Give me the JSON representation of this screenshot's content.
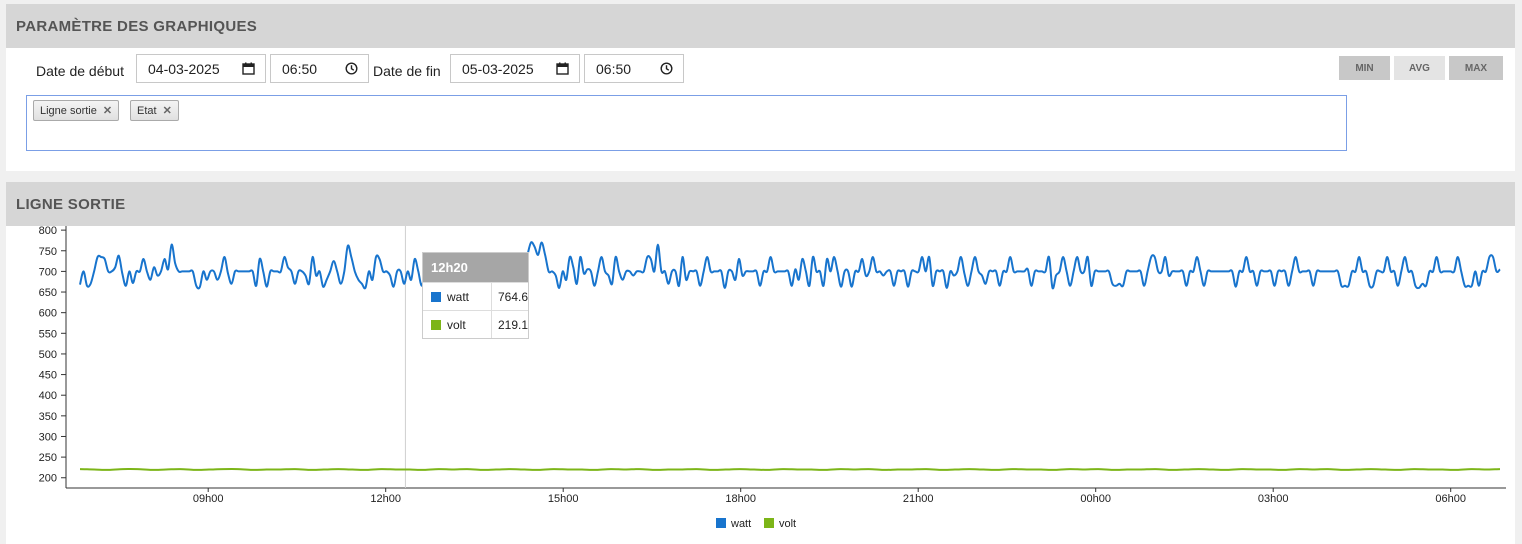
{
  "params": {
    "title": "PARAMÈTRE DES GRAPHIQUES",
    "start_label": "Date de début",
    "start_date": "04-03-2025",
    "start_time": "06:50",
    "end_label": "Date de fin",
    "end_date": "05-03-2025",
    "end_time": "06:50",
    "buttons": {
      "min": "MIN",
      "avg": "AVG",
      "max": "MAX"
    },
    "tags": [
      "Ligne sortie",
      "Etat"
    ]
  },
  "chart_panel": {
    "title": "LIGNE SORTIE"
  },
  "tooltip": {
    "time": "12h20",
    "rows": [
      {
        "name": "watt",
        "value": "764.6"
      },
      {
        "name": "volt",
        "value": "219.1"
      }
    ]
  },
  "colors": {
    "watt": "#1874cd",
    "volt": "#7cb518",
    "header_bg": "#d6d6d6",
    "tag_border": "#7b9fe6"
  },
  "chart_data": {
    "type": "line",
    "x_start": "06:50",
    "x_ticks": [
      "09h00",
      "12h00",
      "15h00",
      "18h00",
      "21h00",
      "00h00",
      "03h00",
      "06h00"
    ],
    "y_ticks": [
      200,
      250,
      300,
      350,
      400,
      450,
      500,
      550,
      600,
      650,
      700,
      750,
      800
    ],
    "ylim": [
      180,
      810
    ],
    "grid": false,
    "legend": "bottom-center",
    "series": [
      {
        "name": "watt",
        "values": [
          668,
          700,
          665,
          670,
          700,
          735,
          735,
          730,
          700,
          700,
          710,
          738,
          695,
          665,
          700,
          672,
          700,
          700,
          730,
          700,
          680,
          710,
          690,
          700,
          730,
          705,
          765,
          720,
          700,
          700,
          700,
          700,
          700,
          665,
          662,
          700,
          680,
          700,
          700,
          680,
          700,
          735,
          695,
          670,
          700,
          700,
          700,
          700,
          700,
          700,
          665,
          730,
          700,
          663,
          700,
          700,
          700,
          700,
          735,
          710,
          700,
          670,
          700,
          700,
          690,
          670,
          735,
          690,
          700,
          663,
          680,
          700,
          725,
          700,
          670,
          700,
          762,
          735,
          700,
          680,
          670,
          660,
          700,
          680,
          735,
          730,
          700,
          700,
          690,
          663,
          700,
          700,
          670,
          700,
          680,
          730,
          700,
          665,
          700,
          700,
          700,
          700,
          665,
          700,
          740,
          705,
          700,
          700,
          720,
          690,
          700,
          735,
          700,
          700,
          700,
          700,
          700,
          730,
          690,
          700,
          730,
          700,
          720,
          700,
          730,
          705,
          700,
          740,
          770,
          760,
          740,
          770,
          740,
          700,
          700,
          690,
          660,
          700,
          680,
          735,
          710,
          670,
          735,
          695,
          705,
          700,
          665,
          700,
          735,
          700,
          690,
          670,
          735,
          700,
          680,
          700,
          700,
          690,
          700,
          700,
          700,
          735,
          730,
          700,
          765,
          700,
          700,
          670,
          700,
          700,
          665,
          735,
          680,
          700,
          700,
          700,
          665,
          700,
          735,
          700,
          700,
          700,
          700,
          660,
          700,
          700,
          680,
          730,
          690,
          700,
          700,
          700,
          700,
          665,
          700,
          700,
          735,
          700,
          700,
          700,
          700,
          700,
          665,
          705,
          680,
          730,
          700,
          665,
          735,
          700,
          700,
          665,
          730,
          700,
          735,
          700,
          663,
          700,
          700,
          663,
          700,
          700,
          730,
          690,
          700,
          735,
          700,
          700,
          690,
          700,
          700,
          665,
          700,
          700,
          700,
          663,
          700,
          700,
          700,
          735,
          700,
          735,
          665,
          700,
          700,
          700,
          660,
          700,
          690,
          700,
          735,
          695,
          665,
          700,
          735,
          700,
          690,
          670,
          700,
          700,
          700,
          665,
          700,
          700,
          735,
          700,
          700,
          700,
          700,
          705,
          665,
          700,
          700,
          700,
          700,
          735,
          660,
          690,
          700,
          735,
          700,
          665,
          700,
          735,
          700,
          700,
          735,
          665,
          700,
          700,
          700,
          700,
          700,
          670,
          665,
          670,
          665,
          700,
          700,
          700,
          700,
          700,
          665,
          700,
          735,
          735,
          700,
          700,
          735,
          690,
          700,
          700,
          700,
          700,
          665,
          700,
          700,
          735,
          700,
          665,
          700,
          700,
          700,
          700,
          700,
          700,
          700,
          700,
          663,
          700,
          700,
          735,
          700,
          700,
          665,
          700,
          700,
          700,
          700,
          665,
          700,
          700,
          700,
          665,
          700,
          735,
          700,
          700,
          700,
          700,
          665,
          700,
          700,
          700,
          700,
          700,
          700,
          700,
          665,
          665,
          665,
          700,
          700,
          735,
          700,
          700,
          665,
          665,
          700,
          700,
          700,
          735,
          700,
          700,
          665,
          700,
          735,
          700,
          700,
          665,
          660,
          670,
          665,
          700,
          700,
          735,
          700,
          700,
          700,
          700,
          700,
          735,
          700,
          665,
          665,
          665,
          700,
          665,
          700,
          700,
          735,
          735,
          700,
          705
        ]
      },
      {
        "name": "volt",
        "values": [
          221,
          220,
          219,
          221,
          221,
          219,
          220,
          221,
          219,
          220,
          221,
          221,
          219,
          220,
          220,
          221,
          219,
          220,
          221,
          220,
          219,
          221,
          220,
          220,
          219,
          221,
          220,
          221,
          219,
          220,
          221,
          220,
          219,
          221,
          220,
          220,
          219,
          221,
          220,
          221,
          219,
          220,
          220,
          221,
          219,
          220,
          221,
          220,
          219,
          221,
          220,
          220,
          219,
          221,
          220,
          221,
          219,
          220,
          220,
          221,
          219,
          220,
          221,
          220,
          219,
          221,
          220,
          220,
          219,
          221,
          220,
          221,
          219,
          220,
          220,
          221,
          219,
          220,
          221,
          220,
          219,
          221,
          220,
          220,
          219,
          221,
          220,
          221,
          219,
          220,
          221,
          220,
          219,
          221,
          220,
          220,
          219,
          221,
          220,
          221
        ]
      }
    ]
  }
}
